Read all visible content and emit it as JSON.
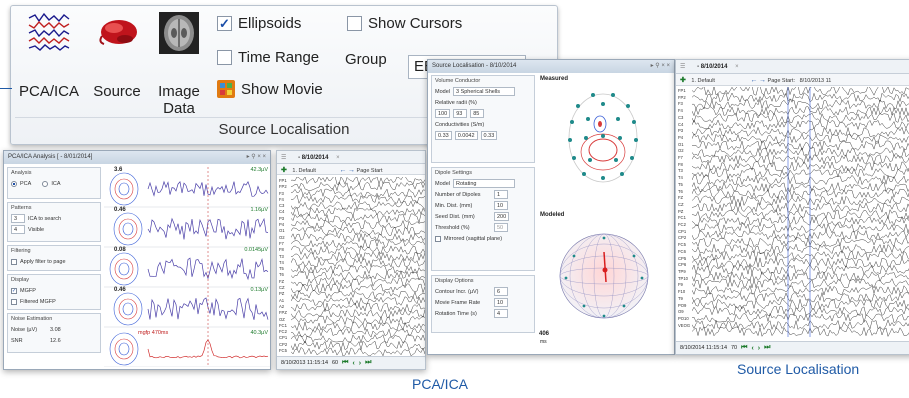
{
  "ribbon": {
    "buttons": [
      {
        "label": "PCA/ICA",
        "icon": "pca-ica-waveforms-icon"
      },
      {
        "label": "Source",
        "icon": "brain-source-icon"
      },
      {
        "label": "Image Data",
        "icon": "mri-brain-icon"
      }
    ],
    "ellipsoids_label": "Ellipsoids",
    "ellipsoids_checked": true,
    "show_cursors_label": "Show Cursors",
    "show_cursors_checked": false,
    "time_range_label": "Time Range",
    "time_range_checked": false,
    "group_label": "Group",
    "group_value": "EEG",
    "show_movie_label": "Show Movie",
    "group_title": "Source Localisation"
  },
  "pca_window": {
    "title": "PCA/ICA Analysis [ - 8/01/2014]",
    "analysis_label": "Analysis",
    "pca_label": "PCA",
    "ica_label": "ICA",
    "patterns_label": "Patterns",
    "ica_to_search_value": "3",
    "ica_to_search_label": "ICA to search",
    "visible_value": "4",
    "visible_label": "Visible",
    "filtering_label": "Filtering",
    "apply_filter_label": "Apply filter to page",
    "display_label": "Display",
    "mgfp_label": "MGFP",
    "filtered_mgfp_label": "Filtered MGFP",
    "noise_label": "Noise Estimation",
    "noise_uv_label": "Noise (µV)",
    "noise_uv_value": "3.08",
    "snr_label": "SNR",
    "snr_value": "12.6",
    "components": [
      {
        "pct": "3.6",
        "amp": "42.3µV"
      },
      {
        "pct": "0.46",
        "amp": "1.16µV"
      },
      {
        "pct": "0.08",
        "amp": "0.0145µV"
      },
      {
        "pct": "0.46",
        "amp": "0.13µV"
      }
    ],
    "bottom_left": "mgfp 470ms",
    "bottom_right": "40.3µV"
  },
  "pca_eeg": {
    "tab": "- 8/10/2014",
    "montage": "1. Default",
    "page_start_label": "Page Start",
    "status_time": "8/10/2013 11:15:14",
    "status_num": "60",
    "channels": [
      "FP1",
      "FP2",
      "F3",
      "F4",
      "C3",
      "C4",
      "P3",
      "P4",
      "O1",
      "O2",
      "F7",
      "F8",
      "T3",
      "T4",
      "T5",
      "T6",
      "FZ",
      "CZ",
      "PZ",
      "A1",
      "A2",
      "FPZ",
      "OZ",
      "FC1",
      "FC2",
      "CP1",
      "CP2",
      "FC5"
    ]
  },
  "source_window": {
    "title": "Source Localisation - 8/10/2014",
    "volume_conductor_label": "Volume Conductor",
    "model_label": "Model",
    "model_value": "3 Spherical Shells",
    "radii_label": "Relative radii (%)",
    "radii": [
      "100",
      "93",
      "85"
    ],
    "cond_label": "Conductivities (S/m)",
    "cond": [
      "0.33",
      "0.0042",
      "0.33"
    ],
    "dipole_settings_label": "Dipole Settings",
    "dipole_model_value": "Rotating",
    "num_dipoles_label": "Number of Dipoles",
    "num_dipoles_value": "1",
    "min_dist_label": "Min. Dist. (mm)",
    "min_dist_value": "10",
    "seed_dist_label": "Seed Dist. (mm)",
    "seed_dist_value": "200",
    "threshold_label": "Threshold (%)",
    "threshold_value": "50",
    "mirrored_label": "Mirrored (sagittal plane)",
    "display_options_label": "Display Options",
    "contour_label": "Contour Incr. (µV)",
    "contour_value": "6",
    "movie_rate_label": "Movie Frame Rate",
    "movie_rate_value": "10",
    "rotation_label": "Rotation Time (s)",
    "rotation_value": "4",
    "measured_label": "Measured",
    "modeled_label": "Modeled",
    "time_ms": "406",
    "time_unit": "ms"
  },
  "source_eeg": {
    "tab": "- 8/10/2014",
    "montage": "1. Default",
    "page_start_label": "Page Start:",
    "page_start_value": "8/10/2013 11",
    "status_time": "8/10/2014 11:15:14",
    "status_num": "70",
    "channels": [
      "FP1",
      "FP2",
      "F3",
      "F4",
      "C3",
      "C4",
      "P3",
      "P4",
      "O1",
      "O2",
      "F7",
      "F8",
      "T3",
      "T4",
      "T5",
      "T6",
      "FZ",
      "CZ",
      "PZ",
      "FC1",
      "FC2",
      "CP1",
      "CP2",
      "FC5",
      "FC6",
      "CP5",
      "CP6",
      "TP9",
      "TP10",
      "F9",
      "F10",
      "T9",
      "PO9",
      "O9",
      "PO10",
      "VEOG"
    ]
  },
  "captions": {
    "pca": "PCA/ICA",
    "source": "Source Localisation"
  },
  "colors": {
    "accent": "#1f5aa6",
    "trace": "#2b2b2b",
    "pca_trace": "#4a3fa8",
    "pca_red": "#d23030"
  }
}
